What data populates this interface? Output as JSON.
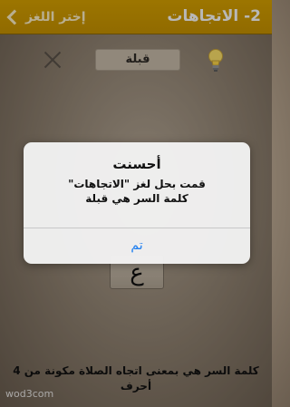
{
  "header": {
    "title": "2- الاتجاهات",
    "back_label": "إختر اللغز",
    "bar_color": "#d9a300"
  },
  "answer": {
    "filled_text": "قبلة"
  },
  "keyboard": {
    "tile_letter": "ع"
  },
  "hint": {
    "text": "كلمة السر هي بمعنى اتجاه الصلاة مكونة من 4 أحرف"
  },
  "watermark": "wod3com",
  "alert": {
    "title": "أحسنت",
    "message_line1": "قمت بحل لغز \"الاتجاهات\"",
    "message_line2": "كلمة السر هي قبلة",
    "button_label": "تم",
    "button_color": "#1a7cf0"
  }
}
